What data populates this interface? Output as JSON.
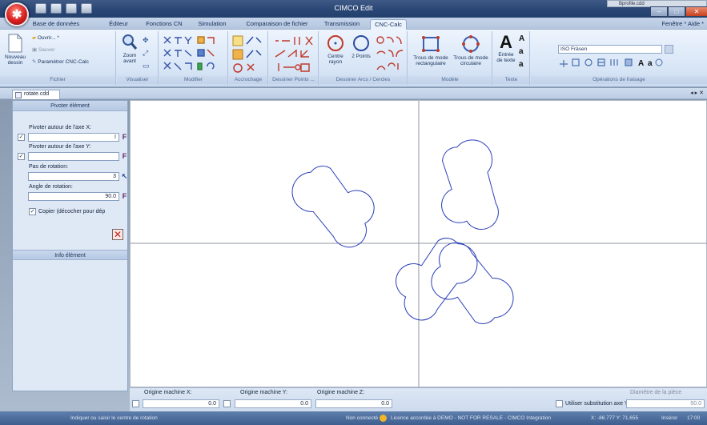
{
  "app": {
    "title": "CIMCO Edit"
  },
  "minibar": {
    "label": "Bprofile.cdd"
  },
  "tabs": [
    {
      "label": "Base de données"
    },
    {
      "label": "Éditeur"
    },
    {
      "label": "Fonctions CN"
    },
    {
      "label": "Simulation"
    },
    {
      "label": "Comparaison de fichier"
    },
    {
      "label": "Transmission"
    },
    {
      "label": "CNC-Calc"
    }
  ],
  "help": {
    "label": "Fenêtre * Aide *"
  },
  "ribbon": {
    "fichier": {
      "label": "Fichier",
      "new": "Nouveau dessin",
      "open": "Ouvrir... *",
      "save": "Sauver",
      "settings": "Paramétrer CNC-Calc"
    },
    "visualiser": {
      "label": "Visualiser",
      "zoom": "Zoom avant"
    },
    "modifier": {
      "label": "Modifier"
    },
    "accrochage": {
      "label": "Accrochage"
    },
    "points": {
      "label": "Dessiner Points ..."
    },
    "arcs": {
      "label": "Dessiner Arcs / Cercles",
      "center": "Centre rayon",
      "twopoints": "2 Points"
    },
    "modele": {
      "label": "Modèle",
      "rect": "Trous de mode rectangulaire",
      "circ": "Trous de mode circulaire"
    },
    "texte": {
      "label": "Texte",
      "entry": "Entrée de texte"
    },
    "fraisage": {
      "label": "Opérations de fraisage",
      "select": "ISO Fräsen"
    }
  },
  "doc": {
    "tab": "rotate.cdd"
  },
  "panel": {
    "title": "Pivoter élément",
    "x_label": "Pivoter autour de l'axe X:",
    "x_value": "I",
    "y_label": "Pivoter autour de l'axe Y:",
    "y_value": "",
    "step_label": "Pas de rotation:",
    "step_value": "3",
    "angle_label": "Angle de rotation:",
    "angle_value": "90.0",
    "copy_label": "Copier (décocher pour dép",
    "info_title": "Info élément"
  },
  "bottom": {
    "ox_label": "Origine machine X:",
    "ox_value": "0.0",
    "oy_label": "Origine machine Y:",
    "oy_value": "0.0",
    "oz_label": "Origine machine Z:",
    "oz_value": "0.0",
    "sub_label": "Utiliser substitution axe Y",
    "diam_label": "Diamètre de la pièce",
    "diam_value": "50.0"
  },
  "status": {
    "hint": "Indiquer ou saisir le centre de rotation",
    "connection": "Non connecté",
    "license": "Licence accordée à DEMO - NOT FOR RESALE - CIMCO Integration",
    "coords": "X: -86.777  Y: 71.655",
    "mode": "Insérer",
    "time": "17:00"
  },
  "colors": {
    "shape": "#2a3fb8",
    "axis": "#8f96a2",
    "titlebar": "#2a4675"
  }
}
